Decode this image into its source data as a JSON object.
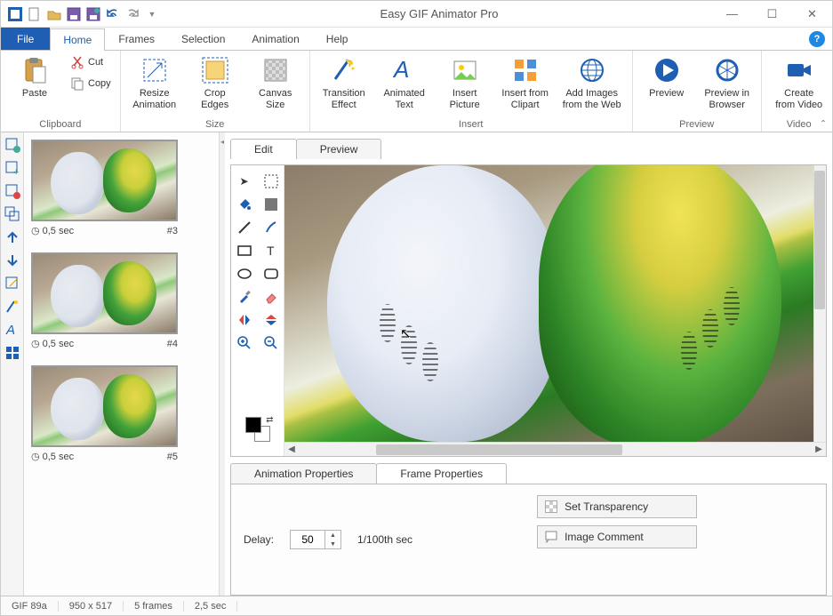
{
  "app": {
    "title": "Easy GIF Animator Pro"
  },
  "tabs": {
    "file": "File",
    "home": "Home",
    "frames": "Frames",
    "selection": "Selection",
    "animation": "Animation",
    "help": "Help"
  },
  "ribbon": {
    "clipboard": {
      "label": "Clipboard",
      "paste": "Paste",
      "cut": "Cut",
      "copy": "Copy"
    },
    "size": {
      "label": "Size",
      "resize": "Resize\nAnimation",
      "crop": "Crop\nEdges",
      "canvas": "Canvas\nSize"
    },
    "insert": {
      "label": "Insert",
      "transition": "Transition\nEffect",
      "animtext": "Animated\nText",
      "picture": "Insert\nPicture",
      "clipart": "Insert from\nClipart",
      "web": "Add Images\nfrom the Web"
    },
    "preview": {
      "label": "Preview",
      "preview": "Preview",
      "browser": "Preview in\nBrowser"
    },
    "video": {
      "label": "Video",
      "create": "Create\nfrom Video"
    }
  },
  "frames": [
    {
      "delay": "0,5 sec",
      "num": "#3"
    },
    {
      "delay": "0,5 sec",
      "num": "#4"
    },
    {
      "delay": "0,5 sec",
      "num": "#5"
    }
  ],
  "editor_tabs": {
    "edit": "Edit",
    "preview": "Preview"
  },
  "props_tabs": {
    "anim": "Animation Properties",
    "frame": "Frame Properties"
  },
  "props": {
    "delay_label": "Delay:",
    "delay_value": "50",
    "delay_unit": "1/100th sec",
    "set_transparency": "Set Transparency",
    "image_comment": "Image Comment"
  },
  "status": {
    "format": "GIF 89a",
    "dims": "950 x 517",
    "frames": "5 frames",
    "duration": "2,5 sec"
  }
}
